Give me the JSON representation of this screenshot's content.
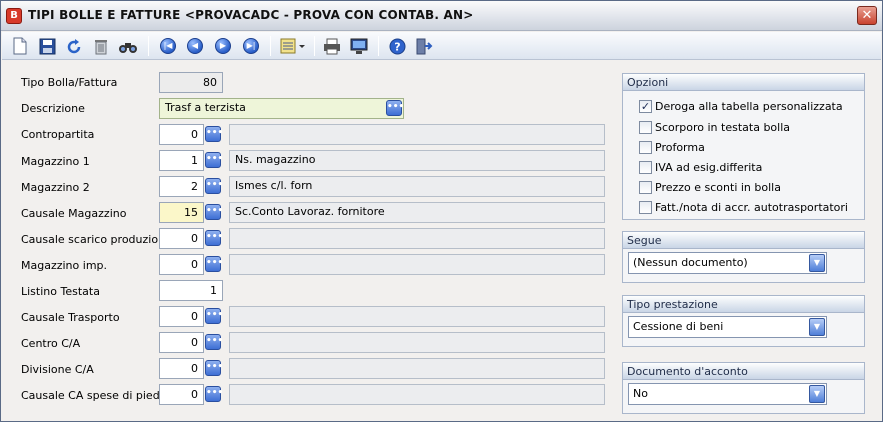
{
  "window": {
    "title": "TIPI BOLLE E FATTURE <PROVACADC - PROVA CON CONTAB. AN>",
    "app_icon_letter": "B",
    "close_glyph": "✕"
  },
  "toolbar": {
    "icons": [
      "new-document-icon",
      "save-icon",
      "undo-icon",
      "delete-icon",
      "find-icon",
      "first-record-icon",
      "previous-record-icon",
      "next-record-icon",
      "last-record-icon",
      "list-view-icon",
      "print-icon",
      "preview-icon",
      "help-icon",
      "exit-icon"
    ]
  },
  "form": {
    "fields": [
      {
        "label": "Tipo Bolla/Fattura",
        "value": "80",
        "desc": ""
      },
      {
        "label": "Descrizione",
        "value": "Trasf a terzista"
      },
      {
        "label": "Contropartita",
        "value": "0",
        "desc": ""
      },
      {
        "label": "Magazzino 1",
        "value": "1",
        "desc": "Ns. magazzino"
      },
      {
        "label": "Magazzino 2",
        "value": "2",
        "desc": "Ismes c/l. forn"
      },
      {
        "label": "Causale Magazzino",
        "value": "15",
        "desc": "Sc.Conto Lavoraz. fornitore"
      },
      {
        "label": "Causale scarico produzione",
        "value": "0",
        "desc": ""
      },
      {
        "label": "Magazzino imp.",
        "value": "0",
        "desc": ""
      },
      {
        "label": "Listino Testata",
        "value": "1"
      },
      {
        "label": "Causale Trasporto",
        "value": "0",
        "desc": ""
      },
      {
        "label": "Centro C/A",
        "value": "0",
        "desc": ""
      },
      {
        "label": "Divisione C/A",
        "value": "0",
        "desc": ""
      },
      {
        "label": "Causale CA spese di piede",
        "value": "0",
        "desc": ""
      }
    ],
    "lookup_glyph": "•••"
  },
  "opzioni": {
    "title": "Opzioni",
    "items": [
      {
        "label": "Deroga alla tabella personalizzata",
        "checked": true
      },
      {
        "label": "Scorporo in testata bolla",
        "checked": false
      },
      {
        "label": "Proforma",
        "checked": false
      },
      {
        "label": "IVA ad esig.differita",
        "checked": false
      },
      {
        "label": "Prezzo e sconti in bolla",
        "checked": false
      },
      {
        "label": "Fatt./nota di accr. autotrasportatori",
        "checked": false
      }
    ],
    "check_glyph": "✓"
  },
  "segue": {
    "title": "Segue",
    "value": "(Nessun documento)"
  },
  "tipo_prestazione": {
    "title": "Tipo prestazione",
    "value": "Cessione di beni"
  },
  "documento_acconto": {
    "title": "Documento d'acconto",
    "value": "No"
  },
  "combo_glyph": "▼"
}
